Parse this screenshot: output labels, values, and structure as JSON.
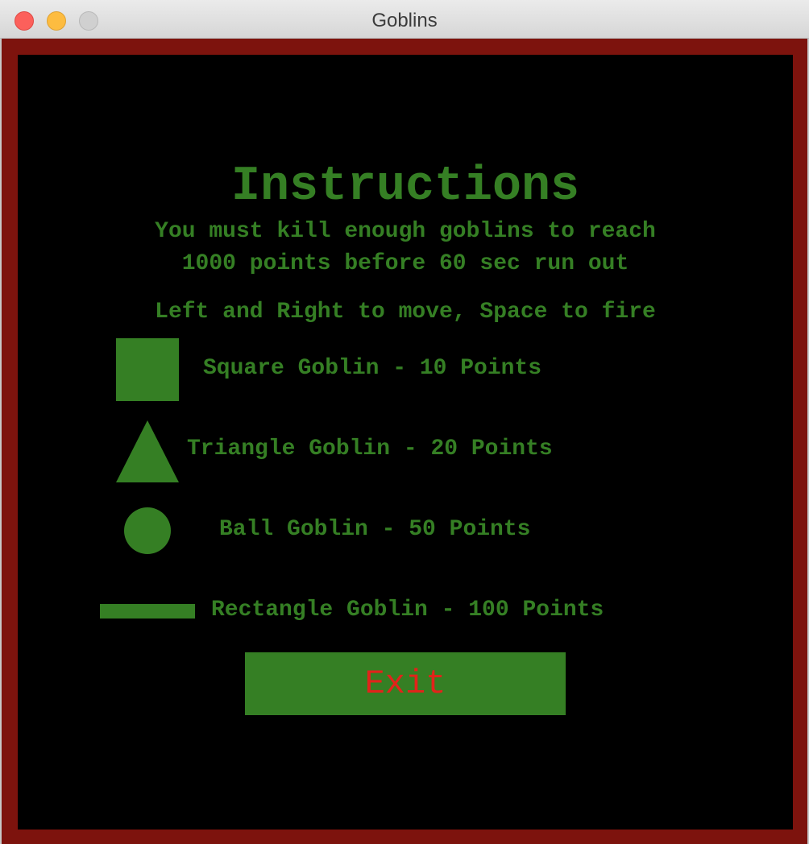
{
  "window": {
    "title": "Goblins"
  },
  "instructions": {
    "heading": "Instructions",
    "goal_line_1": "You must kill enough goblins to reach",
    "goal_line_2": "1000 points before 60 sec run out",
    "controls": "Left and Right to move, Space to fire"
  },
  "goblins": [
    {
      "shape": "square",
      "label": "Square Goblin - 10 Points"
    },
    {
      "shape": "triangle",
      "label": "Triangle Goblin - 20 Points"
    },
    {
      "shape": "circle",
      "label": "Ball Goblin - 50 Points"
    },
    {
      "shape": "rectangle",
      "label": "Rectangle Goblin - 100 Points"
    }
  ],
  "exit_button": {
    "label": "Exit"
  },
  "colors": {
    "frame": "#7d130d",
    "background": "#000000",
    "text": "#357f24",
    "button_text": "#e2231a"
  }
}
